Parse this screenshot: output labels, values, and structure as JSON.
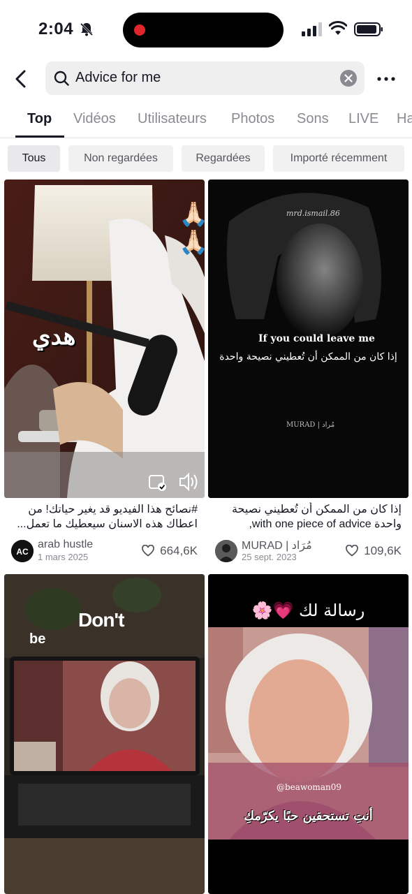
{
  "status_bar": {
    "time": "2:04"
  },
  "search": {
    "query": "Advice for me"
  },
  "tabs": [
    {
      "label": "Top",
      "active": true
    },
    {
      "label": "Vidéos"
    },
    {
      "label": "Utilisateurs"
    },
    {
      "label": "Photos"
    },
    {
      "label": "Sons"
    },
    {
      "label": "LIVE"
    },
    {
      "label": "Ha"
    }
  ],
  "chips": [
    {
      "label": "Tous",
      "active": true
    },
    {
      "label": "Non regardées"
    },
    {
      "label": "Regardées"
    },
    {
      "label": "Importé récemment"
    }
  ],
  "videos": [
    {
      "overlay_emoji": "🙏🏻🙏🏻",
      "overlay_word": "هدي",
      "caption": "#نصائح هذا الفيديو قد يغير حياتك! من اعطاك هذه الاسنان سيعطيك ما تعمل...",
      "author": "arab hustle",
      "avatar_initials": "AC",
      "date": "1 mars 2025",
      "likes": "664,6K"
    },
    {
      "watermark": "mrd.ismail.86",
      "overlay_en": "If you could leave me",
      "overlay_ar": "إذا كان من الممكن أن تُعطيني نصيحة واحدة",
      "overlay_sig": "MURAD | مُراد",
      "caption": "إذا كان من الممكن أن تُعطيني نصيحة واحدة with one piece of advice,",
      "author": "MURAD | مُرَاد",
      "date": "25 sept. 2023",
      "likes": "109,6K"
    },
    {
      "overlay_word1": "Don't",
      "overlay_word2": "be"
    },
    {
      "overlay_title": "رسالة لك 💗🌸",
      "overlay_handle": "@beawoman09",
      "overlay_sub": "أنتِ تستحقين حبًا يكرّمكِ"
    }
  ],
  "colors": {
    "accent": "#161823",
    "muted": "#8a8b91",
    "chip_bg": "#f1f1f2"
  }
}
